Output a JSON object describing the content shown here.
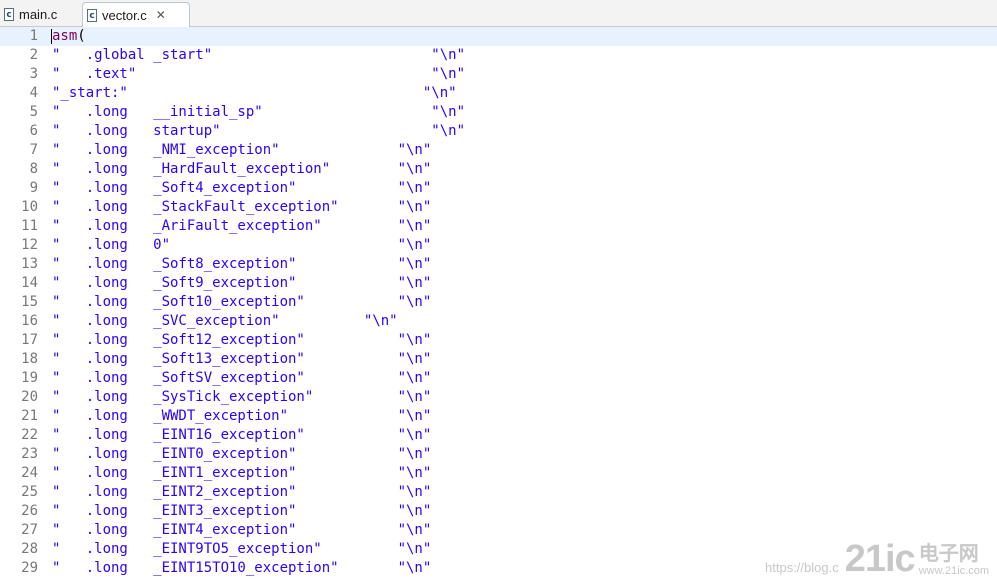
{
  "tabs": [
    {
      "label": "main.c",
      "icon": "c-file-icon",
      "active": false
    },
    {
      "label": "vector.c",
      "icon": "c-file-icon",
      "active": true,
      "close": "✕"
    }
  ],
  "code_lines": [
    {
      "n": "1",
      "keyword": "asm",
      "rest": "("
    },
    {
      "n": "2",
      "text": "\"   .global _start\"                          \"\\n\""
    },
    {
      "n": "3",
      "text": "\"   .text\"                                   \"\\n\""
    },
    {
      "n": "4",
      "text": "\"_start:\"                                   \"\\n\""
    },
    {
      "n": "5",
      "text": "\"   .long   __initial_sp\"                    \"\\n\""
    },
    {
      "n": "6",
      "text": "\"   .long   startup\"                         \"\\n\""
    },
    {
      "n": "7",
      "text": "\"   .long   _NMI_exception\"              \"\\n\""
    },
    {
      "n": "8",
      "text": "\"   .long   _HardFault_exception\"        \"\\n\""
    },
    {
      "n": "9",
      "text": "\"   .long   _Soft4_exception\"            \"\\n\""
    },
    {
      "n": "10",
      "text": "\"   .long   _StackFault_exception\"       \"\\n\""
    },
    {
      "n": "11",
      "text": "\"   .long   _AriFault_exception\"         \"\\n\""
    },
    {
      "n": "12",
      "text": "\"   .long   0\"                           \"\\n\""
    },
    {
      "n": "13",
      "text": "\"   .long   _Soft8_exception\"            \"\\n\""
    },
    {
      "n": "14",
      "text": "\"   .long   _Soft9_exception\"            \"\\n\""
    },
    {
      "n": "15",
      "text": "\"   .long   _Soft10_exception\"           \"\\n\""
    },
    {
      "n": "16",
      "text": "\"   .long   _SVC_exception\"          \"\\n\""
    },
    {
      "n": "17",
      "text": "\"   .long   _Soft12_exception\"           \"\\n\""
    },
    {
      "n": "18",
      "text": "\"   .long   _Soft13_exception\"           \"\\n\""
    },
    {
      "n": "19",
      "text": "\"   .long   _SoftSV_exception\"           \"\\n\""
    },
    {
      "n": "20",
      "text": "\"   .long   _SysTick_exception\"          \"\\n\""
    },
    {
      "n": "21",
      "text": "\"   .long   _WWDT_exception\"             \"\\n\""
    },
    {
      "n": "22",
      "text": "\"   .long   _EINT16_exception\"           \"\\n\""
    },
    {
      "n": "23",
      "text": "\"   .long   _EINT0_exception\"            \"\\n\""
    },
    {
      "n": "24",
      "text": "\"   .long   _EINT1_exception\"            \"\\n\""
    },
    {
      "n": "25",
      "text": "\"   .long   _EINT2_exception\"            \"\\n\""
    },
    {
      "n": "26",
      "text": "\"   .long   _EINT3_exception\"            \"\\n\""
    },
    {
      "n": "27",
      "text": "\"   .long   _EINT4_exception\"            \"\\n\""
    },
    {
      "n": "28",
      "text": "\"   .long   _EINT9TO5_exception\"         \"\\n\""
    },
    {
      "n": "29",
      "text": "\"   .long   _EINT15TO10_exception\"       \"\\n\""
    }
  ],
  "watermark": {
    "url_text": "https://blog.c",
    "logo": "21ic",
    "cn_name": "电子网",
    "cn_sub": "www.21ic.com"
  }
}
